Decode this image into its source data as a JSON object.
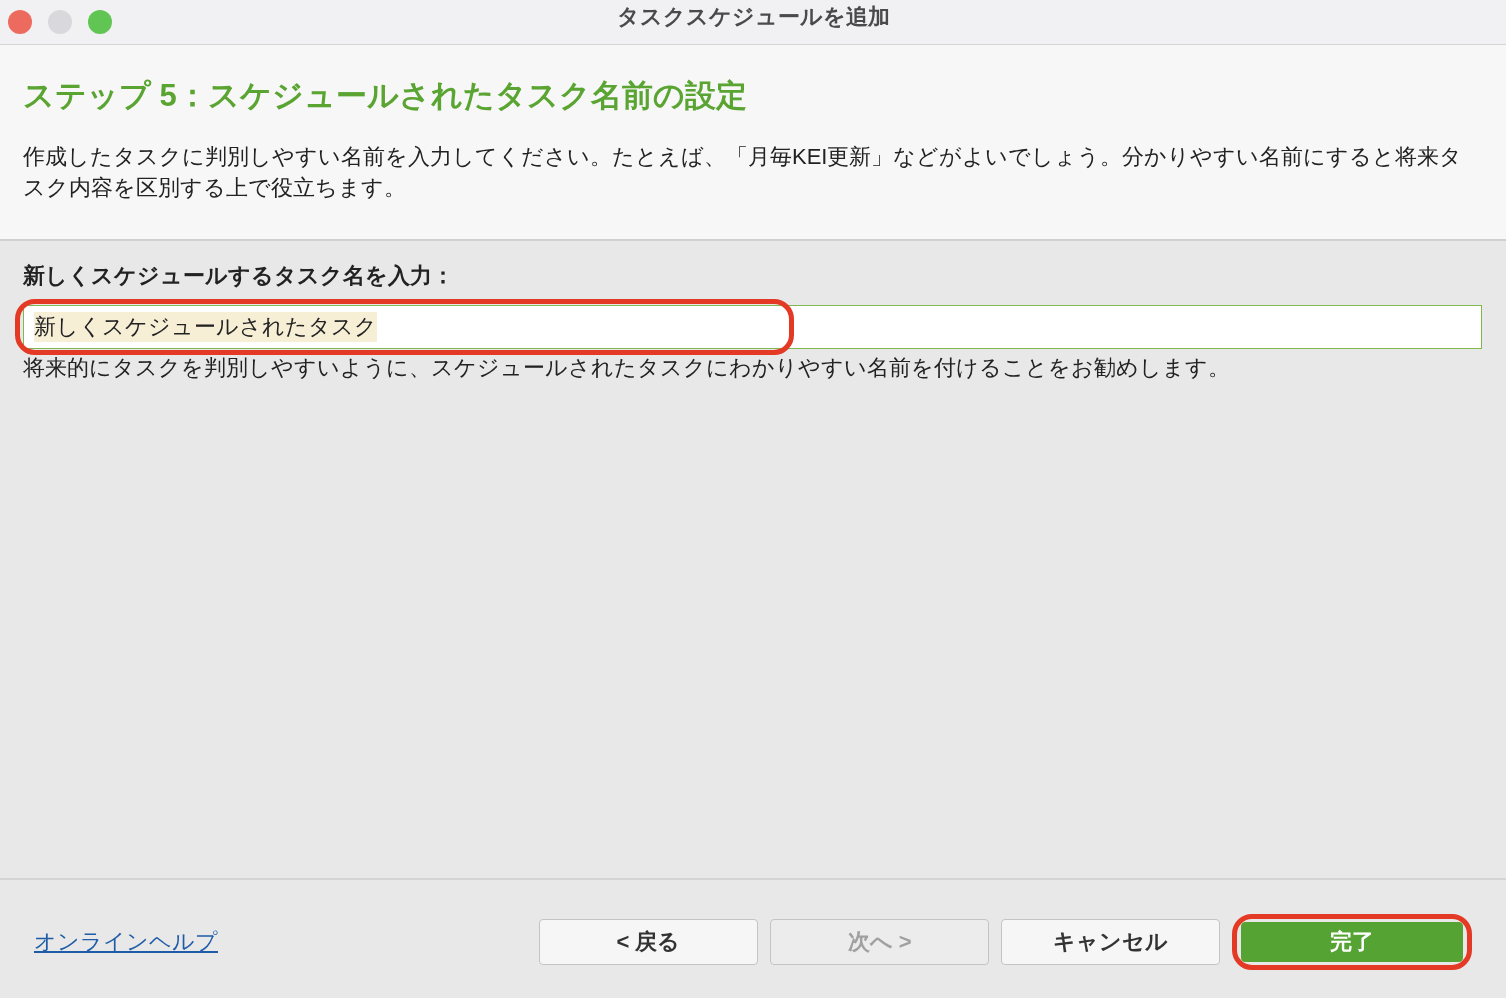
{
  "window": {
    "title": "タスクスケジュールを追加"
  },
  "header": {
    "heading": "ステップ 5：スケジュールされたタスク名前の設定",
    "description": "作成したタスクに判別しやすい名前を入力してください。たとえば、「月毎KEI更新」などがよいでしょう。分かりやすい名前にすると将来タスク内容を区別する上で役立ちます。"
  },
  "form": {
    "label": "新しくスケジュールするタスク名を入力：",
    "value": "新しくスケジュールされたタスク",
    "value_selected": true,
    "highlighted": true,
    "hint": "将来的にタスクを判別しやすいように、スケジュールされたタスクにわかりやすい名前を付けることをお勧めします。"
  },
  "footer": {
    "help_link": "オンラインヘルプ",
    "buttons": [
      {
        "label": "< 戻る",
        "kind": "normal",
        "disabled": false,
        "highlighted": false
      },
      {
        "label": "次へ >",
        "kind": "normal",
        "disabled": true,
        "highlighted": false
      },
      {
        "label": "キャンセル",
        "kind": "normal",
        "disabled": false,
        "highlighted": false
      },
      {
        "label": "完了",
        "kind": "primary",
        "disabled": false,
        "highlighted": true
      }
    ]
  }
}
